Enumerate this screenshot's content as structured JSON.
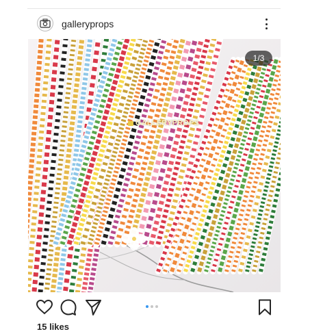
{
  "post": {
    "username": "galleryprops",
    "image_counter": "1/3",
    "watermark_text": "GALLERYPROPS",
    "likes": "15 likes",
    "carousel_total": 3,
    "carousel_active_index": 0
  },
  "icons": {
    "avatar": "camera-logo-icon",
    "more": "more-options-icon",
    "like": "heart-icon",
    "comment": "comment-icon",
    "share": "paper-plane-icon",
    "save": "bookmark-icon"
  },
  "colors": {
    "text": "#262626",
    "carousel_active": "#3897f0",
    "carousel_inactive": "#c7c7c7"
  }
}
